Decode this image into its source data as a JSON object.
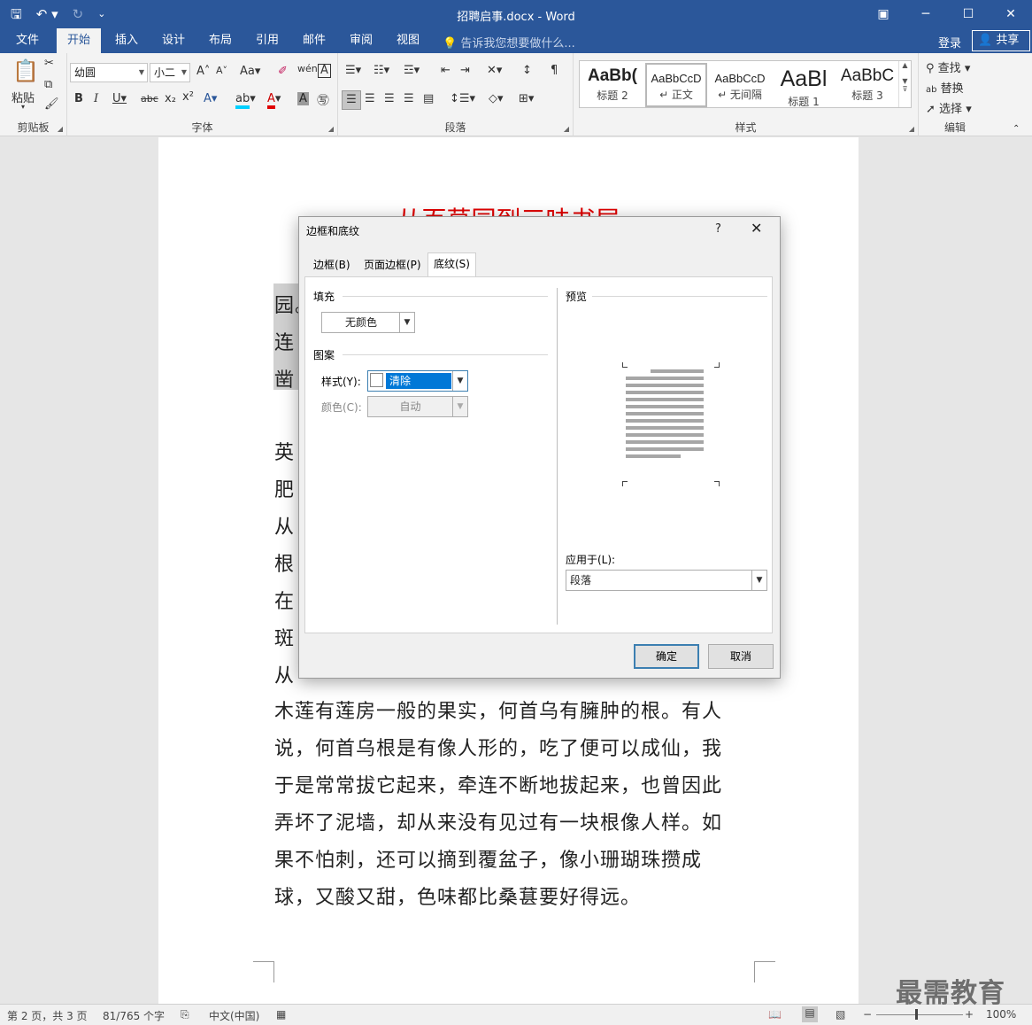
{
  "window": {
    "title": "招聘启事.docx - Word"
  },
  "tabs": [
    "文件",
    "开始",
    "插入",
    "设计",
    "布局",
    "引用",
    "邮件",
    "审阅",
    "视图"
  ],
  "tell_me": "告诉我您想要做什么...",
  "account": {
    "login": "登录",
    "share": "共享"
  },
  "ribbon": {
    "clipboard": {
      "paste": "粘贴",
      "label": "剪贴板"
    },
    "font": {
      "name": "幼圆",
      "size": "小二",
      "label": "字体"
    },
    "paragraph": {
      "label": "段落"
    },
    "styles": {
      "label": "样式",
      "items": [
        {
          "preview": "AaBb(",
          "name": "标题 2"
        },
        {
          "preview": "AaBbCcD",
          "name": "↵ 正文"
        },
        {
          "preview": "AaBbCcD",
          "name": "↵ 无间隔"
        },
        {
          "preview": "AaBl",
          "name": "标题 1"
        },
        {
          "preview": "AaBbC",
          "name": "标题 3"
        }
      ]
    },
    "editing": {
      "find": "查找",
      "replace": "替换",
      "select": "选择",
      "label": "编辑"
    }
  },
  "document": {
    "heading": "从百草园到三味书屋",
    "highlighted_chars": [
      "园。",
      "连",
      "凿"
    ],
    "partial_lines": [
      "英",
      "肥",
      "从",
      "根",
      "在",
      "斑",
      "从"
    ],
    "lines": [
      "木莲有莲房一般的果实，何首乌有臃肿的根。有人",
      "说，何首乌根是有像人形的，吃了便可以成仙，我",
      "于是常常拔它起来，牵连不断地拔起来，也曾因此",
      "弄坏了泥墙，却从来没有见过有一块根像人样。如",
      "果不怕刺，还可以摘到覆盆子，像小珊瑚珠攒成",
      "球，又酸又甜，色味都比桑葚要好得远。"
    ]
  },
  "dialog": {
    "title": "边框和底纹",
    "help": "?",
    "tabs": [
      "边框(B)",
      "页面边框(P)",
      "底纹(S)"
    ],
    "fill_label": "填充",
    "fill_value": "无颜色",
    "pattern_label": "图案",
    "style_label": "样式(Y):",
    "style_value": "清除",
    "color_label": "颜色(C):",
    "color_value": "自动",
    "preview_label": "预览",
    "apply_label": "应用于(L):",
    "apply_value": "段落",
    "ok": "确定",
    "cancel": "取消"
  },
  "status": {
    "page": "第 2 页，共 3 页",
    "words": "81/765 个字",
    "language": "中文(中国)",
    "zoom": "100%",
    "zoom_level": 100
  },
  "watermark": "最需教育"
}
